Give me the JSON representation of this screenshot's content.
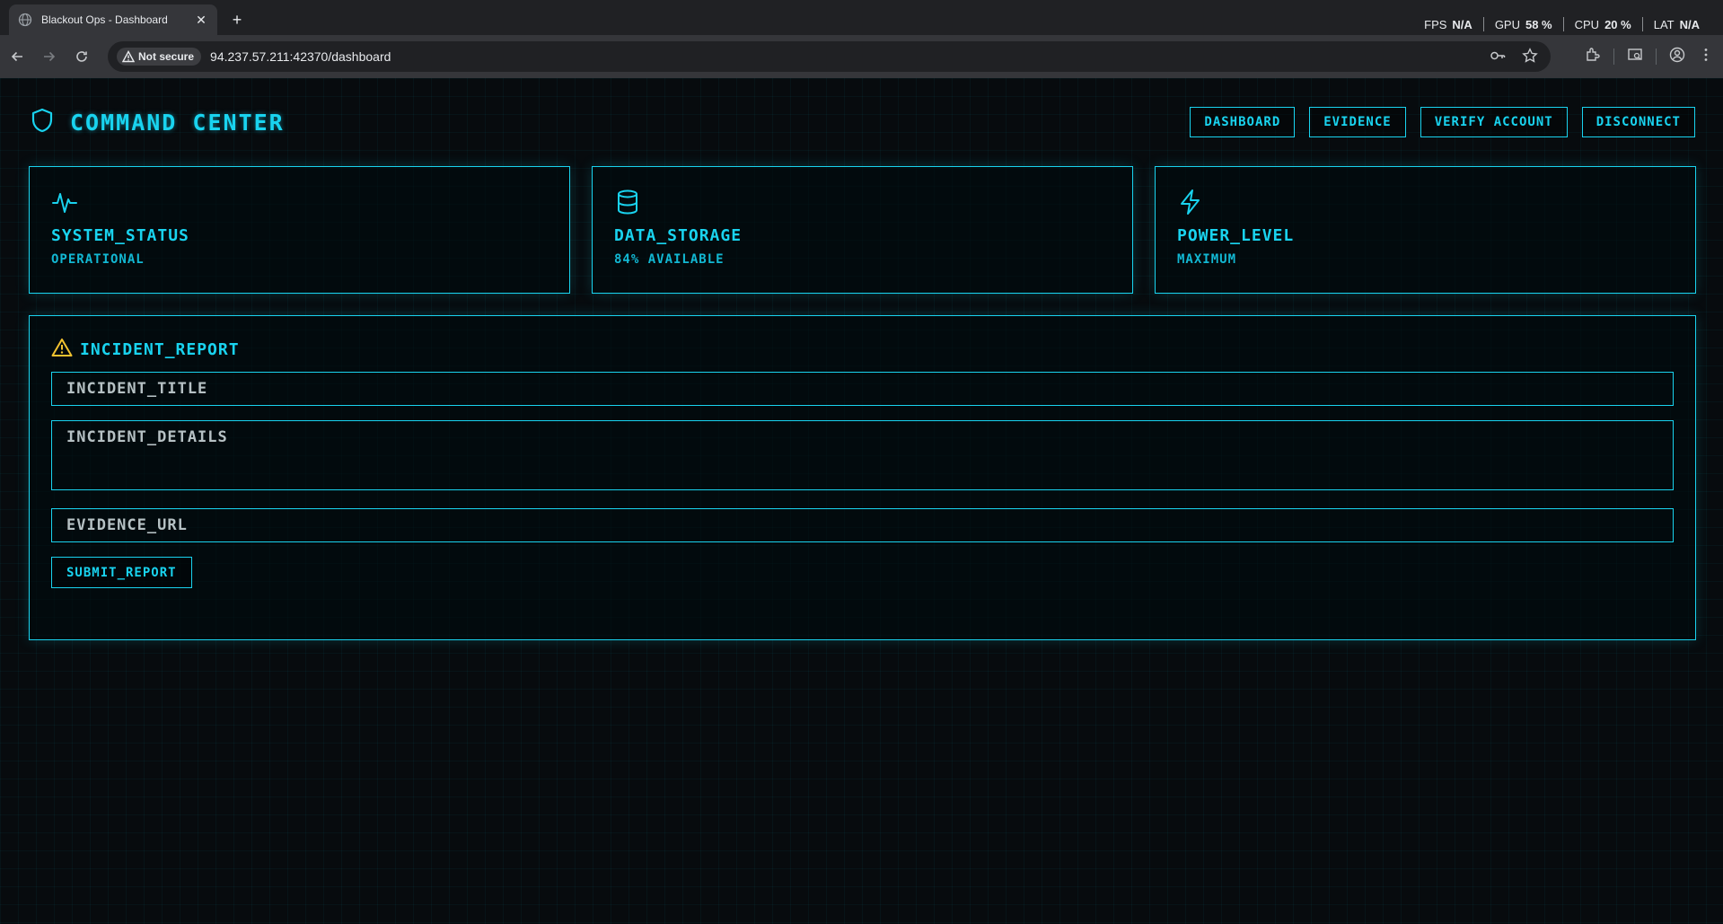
{
  "browser": {
    "tab_title": "Blackout Ops - Dashboard",
    "security_label": "Not secure",
    "url": "94.237.57.211:42370/dashboard",
    "perf": [
      {
        "label": "FPS",
        "value": "N/A"
      },
      {
        "label": "GPU",
        "value": "58 %"
      },
      {
        "label": "CPU",
        "value": "20 %"
      },
      {
        "label": "LAT",
        "value": "N/A"
      }
    ]
  },
  "app": {
    "title": "COMMAND CENTER",
    "nav": [
      "DASHBOARD",
      "EVIDENCE",
      "VERIFY ACCOUNT",
      "DISCONNECT"
    ],
    "cards": [
      {
        "icon": "activity-icon",
        "title": "SYSTEM_STATUS",
        "subtitle": "OPERATIONAL"
      },
      {
        "icon": "database-icon",
        "title": "DATA_STORAGE",
        "subtitle": "84% AVAILABLE"
      },
      {
        "icon": "lightning-icon",
        "title": "POWER_LEVEL",
        "subtitle": "MAXIMUM"
      }
    ],
    "incident": {
      "title": "INCIDENT_REPORT",
      "title_placeholder": "INCIDENT_TITLE",
      "details_placeholder": "INCIDENT_DETAILS",
      "url_placeholder": "EVIDENCE_URL",
      "submit_label": "SUBMIT_REPORT"
    }
  },
  "colors": {
    "accent": "#19d3ef",
    "warning": "#f2c230",
    "background": "#070b0e"
  }
}
